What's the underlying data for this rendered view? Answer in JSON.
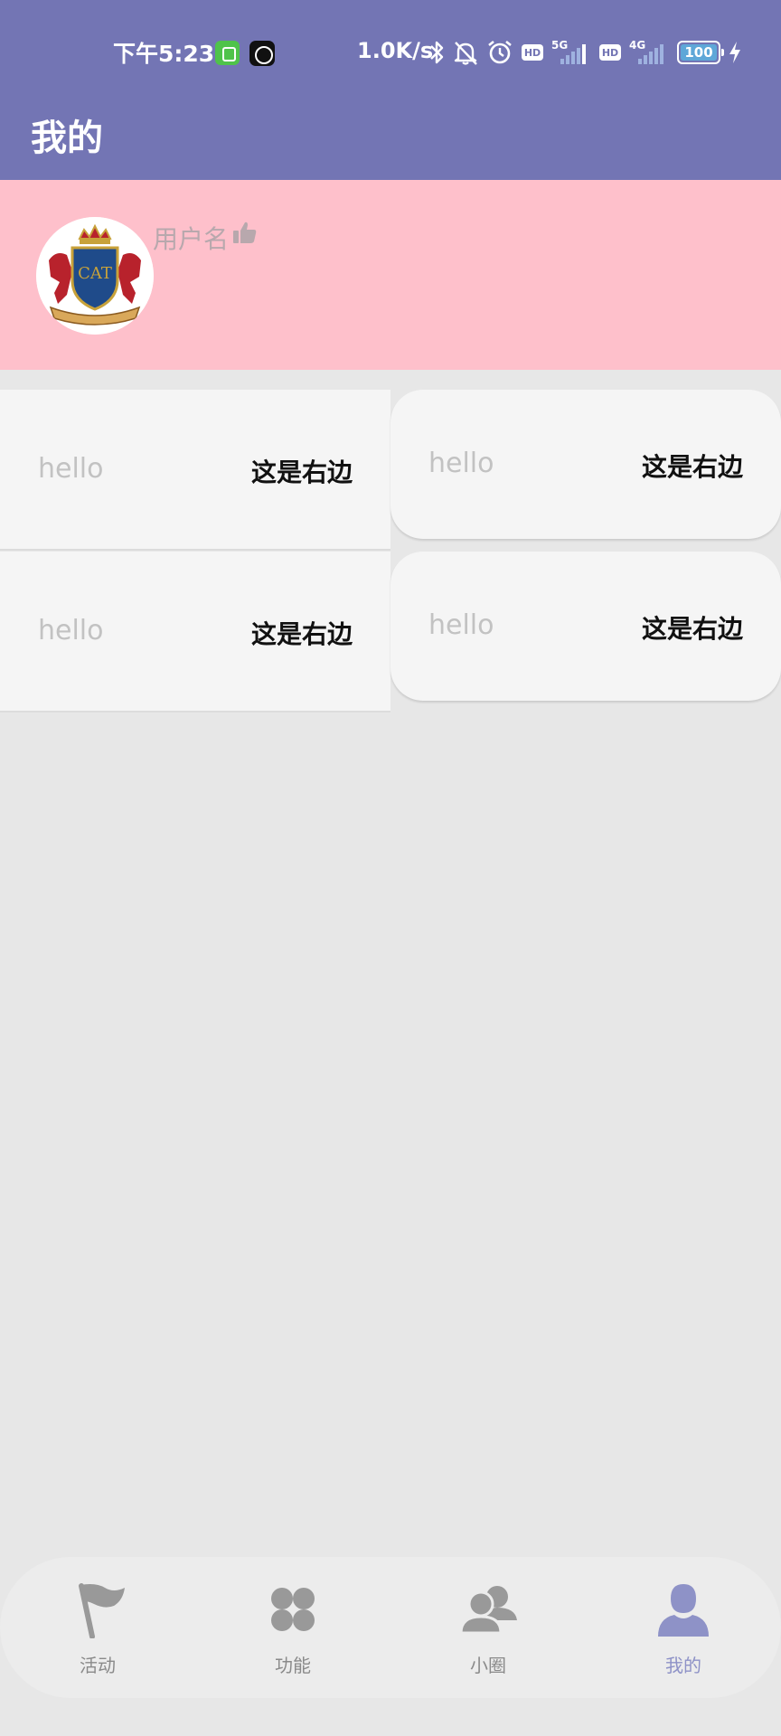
{
  "status_bar": {
    "time": "下午5:23",
    "net_speed": "1.0K/s",
    "sim1_type": "5G",
    "sim2_type": "4G",
    "hd_label": "HD",
    "battery": "100",
    "icons": [
      "app-notification-icon",
      "clock-app-icon",
      "bluetooth-icon",
      "mute-icon",
      "alarm-icon",
      "signal-icon",
      "battery-icon",
      "charging-icon"
    ]
  },
  "app_bar": {
    "title": "我的"
  },
  "profile": {
    "username": "用户名",
    "avatar_icon": "cat-crest-avatar",
    "like_icon": "thumb-up-icon"
  },
  "cards": [
    {
      "left": "hello",
      "right": "这是右边"
    },
    {
      "left": "hello",
      "right": "这是右边"
    },
    {
      "left": "hello",
      "right": "这是右边"
    },
    {
      "left": "hello",
      "right": "这是右边"
    }
  ],
  "bottom_nav": {
    "items": [
      {
        "label": "活动",
        "icon": "flag-icon",
        "active": false
      },
      {
        "label": "功能",
        "icon": "grid-dots-icon",
        "active": false
      },
      {
        "label": "小圈",
        "icon": "group-icon",
        "active": false
      },
      {
        "label": "我的",
        "icon": "person-icon",
        "active": true
      }
    ]
  },
  "colors": {
    "primary": "#7375b4",
    "profile_bg": "#fec0cb",
    "page_bg": "#e7e7e7",
    "card_bg": "#f5f5f5",
    "nav_active": "#8e92c7",
    "nav_inactive": "#8a8a8a"
  }
}
